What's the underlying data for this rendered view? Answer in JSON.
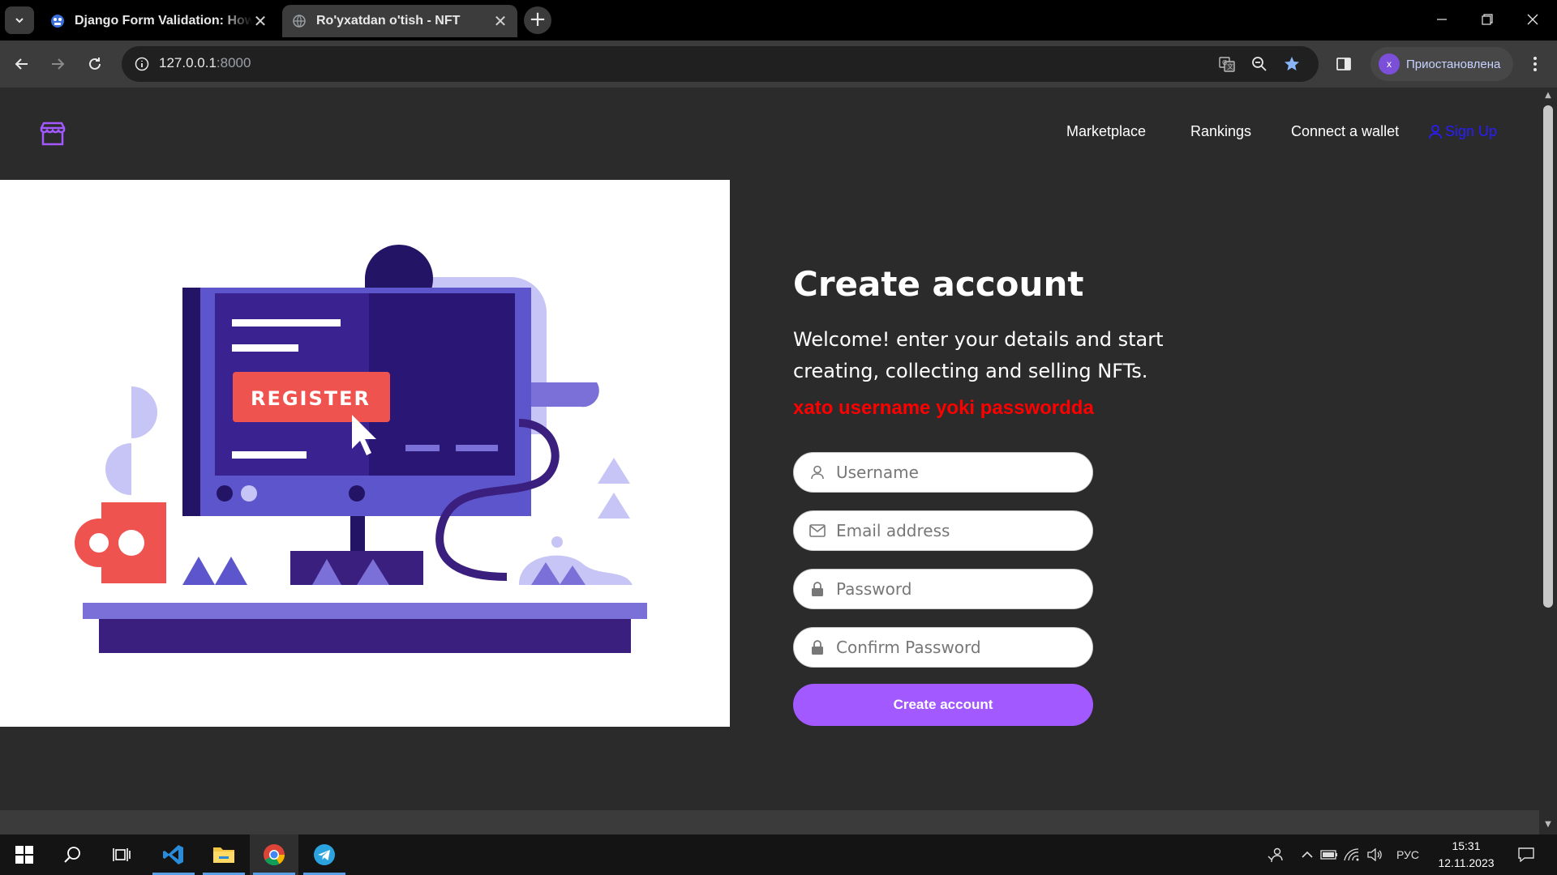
{
  "browser": {
    "tabs": [
      {
        "title": "Django Form Validation: How to",
        "active": false
      },
      {
        "title": "Ro'yxatdan o'tish - NFT",
        "active": true
      }
    ],
    "url_host": "127.0.0.1",
    "url_port": ":8000",
    "profile_initial": "x",
    "profile_label": "Приостановлена"
  },
  "site": {
    "nav": {
      "marketplace": "Marketplace",
      "rankings": "Rankings",
      "connect_wallet": "Connect a wallet",
      "sign_up": "Sign Up"
    },
    "illustration": {
      "button_text": "REGISTER"
    },
    "form": {
      "title": "Create account",
      "subtitle": "Welcome! enter your details and start creating, collecting and selling NFTs.",
      "error": "xato username yoki passwordda",
      "username_placeholder": "Username",
      "email_placeholder": "Email address",
      "password_placeholder": "Password",
      "confirm_placeholder": "Confirm Password",
      "submit_label": "Create account"
    }
  },
  "taskbar": {
    "language": "РУС",
    "time": "15:31",
    "date": "12.11.2023"
  },
  "colors": {
    "accent": "#a259ff",
    "error": "#ff0000",
    "signup_link": "#2a1cff",
    "page_bg": "#2b2b2b"
  }
}
